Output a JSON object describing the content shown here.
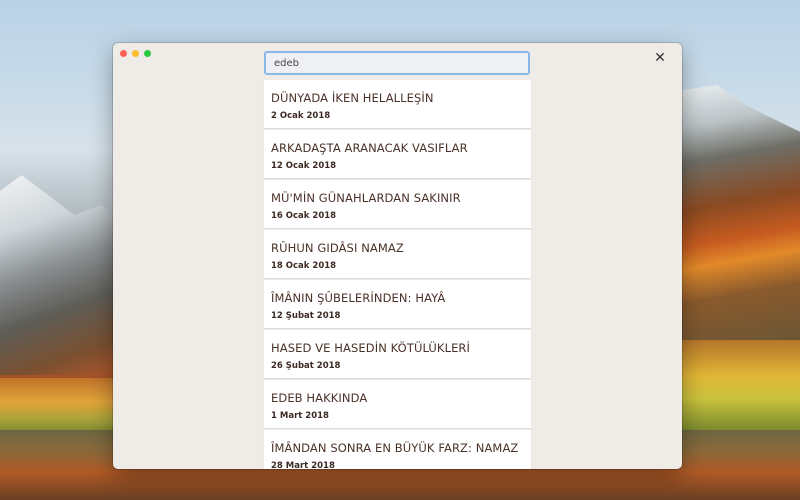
{
  "window": {
    "close_glyph": "✕"
  },
  "search": {
    "value": "edeb",
    "placeholder": ""
  },
  "articles": [
    {
      "title": "DÜNYADA İKEN HELALLEŞİN",
      "date": "2 Ocak 2018"
    },
    {
      "title": "ARKADAŞTA ARANACAK VASIFLAR",
      "date": "12 Ocak 2018"
    },
    {
      "title": "MÜ'MİN GÜNAHLARDAN SAKINIR",
      "date": "16 Ocak 2018"
    },
    {
      "title": "RÛHUN GIDÂSI NAMAZ",
      "date": "18 Ocak 2018"
    },
    {
      "title": "ÎMÂNIN ŞÛBELERİNDEN: HAYÂ",
      "date": "12 Şubat 2018"
    },
    {
      "title": "HASED VE HASEDİN KÖTÜLÜKLERİ",
      "date": "26 Şubat 2018"
    },
    {
      "title": "EDEB HAKKINDA",
      "date": "1 Mart 2018"
    },
    {
      "title": "ÎMÂNDAN SONRA EN BÜYÜK FARZ: NAMAZ",
      "date": "28 Mart 2018"
    }
  ],
  "colors": {
    "window_bg": "#efebe7",
    "card_bg": "#ffffff",
    "title_text": "#4a3128",
    "search_focus": "#8ab8e6"
  }
}
